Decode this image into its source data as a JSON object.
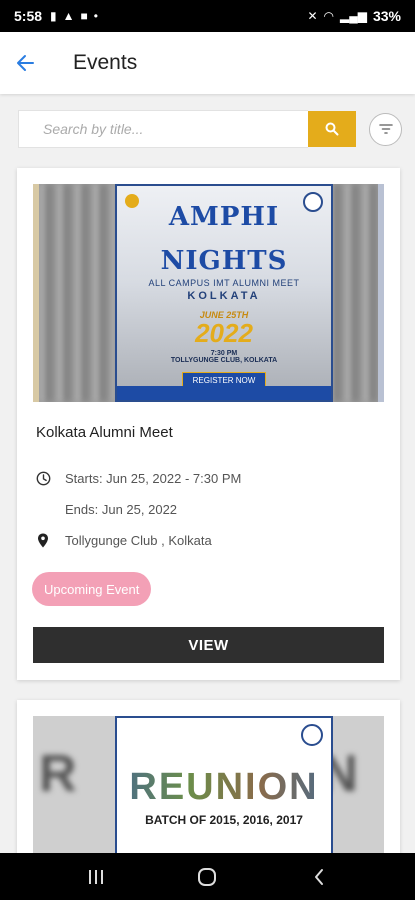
{
  "status_bar": {
    "time": "5:58",
    "battery": "33%"
  },
  "app_bar": {
    "title": "Events"
  },
  "search": {
    "placeholder": "Search by title..."
  },
  "events": [
    {
      "title": "Kolkata Alumni Meet",
      "starts": "Starts: Jun 25, 2022 - 7:30 PM",
      "ends": "Ends: Jun 25, 2022",
      "venue": "Tollygunge Club , Kolkata",
      "status": "Upcoming Event",
      "view_label": "VIEW",
      "poster": {
        "title_line1": "AMPHI",
        "title_line2": "NIGHTS",
        "subtitle": "ALL CAMPUS IMT ALUMNI MEET",
        "city": "KOLKATA",
        "date": "JUNE 25TH",
        "year": "2022",
        "time": "7:30 PM",
        "venue": "TOLLYGUNGE CLUB, KOLKATA",
        "cta": "REGISTER NOW"
      }
    },
    {
      "poster": {
        "title": "REUNION",
        "subtitle": "BATCH OF 2015, 2016, 2017"
      }
    }
  ],
  "colors": {
    "accent": "#e4ac1b",
    "back_arrow": "#2a7de1",
    "badge": "#f3a0b6",
    "button": "#2f2f2f",
    "poster_blue": "#1d4ba5"
  }
}
